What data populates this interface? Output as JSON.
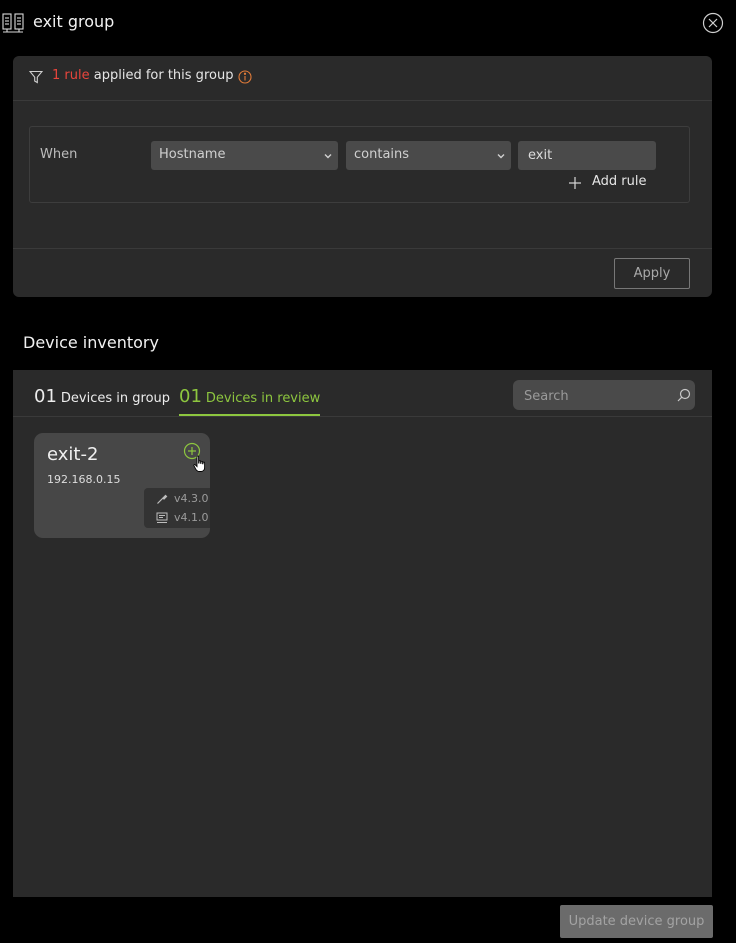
{
  "header": {
    "title": "exit group"
  },
  "rules": {
    "count_text": "1 rule",
    "suffix_text": "applied for this group",
    "when_label": "When",
    "field_value": "Hostname",
    "operator_value": "contains",
    "match_value": "exit",
    "add_rule_label": "Add rule",
    "apply_label": "Apply"
  },
  "inventory": {
    "title": "Device inventory",
    "tabs": [
      {
        "num": "01",
        "label": "Devices in group"
      },
      {
        "num": "01",
        "label": "Devices in review"
      }
    ],
    "search_placeholder": "Search",
    "devices": [
      {
        "name": "exit-2",
        "ip": "192.168.0.15",
        "version_a": "v4.3.0",
        "version_b": "v4.1.0"
      }
    ]
  },
  "footer": {
    "update_label": "Update device group"
  },
  "colors": {
    "accent": "#8dc63f",
    "alert": "#e8453c",
    "info": "#e07b39"
  }
}
